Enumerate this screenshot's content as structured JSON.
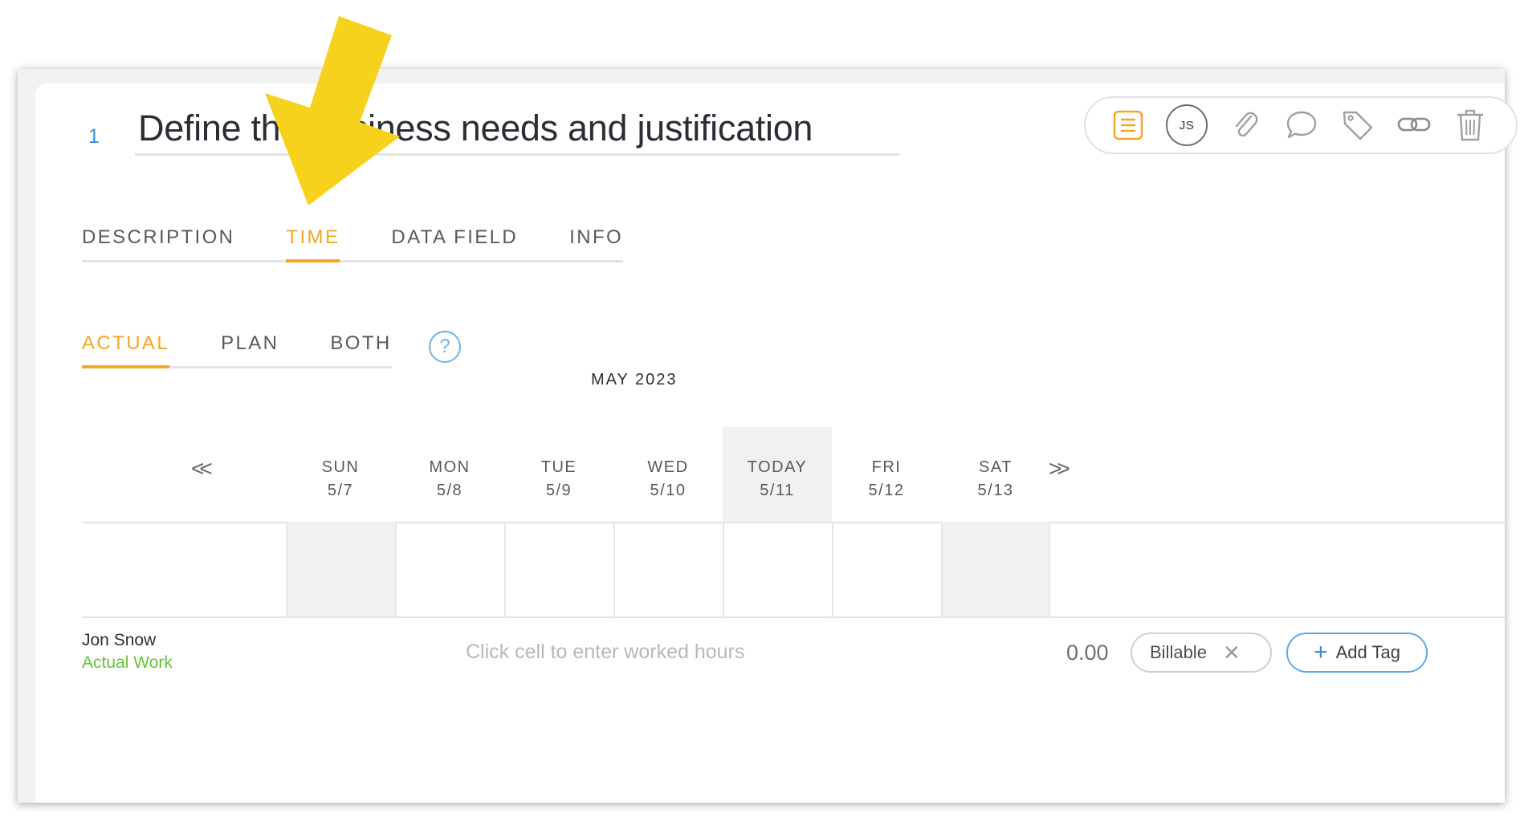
{
  "task": {
    "number": "1",
    "title": "Define the business needs and justification"
  },
  "toolbar": {
    "avatar_initials": "JS",
    "icons": [
      "list-icon",
      "avatar",
      "paperclip-icon",
      "comment-icon",
      "tag-icon",
      "link-icon",
      "trash-icon"
    ]
  },
  "tabs": [
    {
      "label": "DESCRIPTION",
      "active": false
    },
    {
      "label": "TIME",
      "active": true
    },
    {
      "label": "DATA FIELD",
      "active": false
    },
    {
      "label": "INFO",
      "active": false
    }
  ],
  "subtabs": [
    {
      "label": "ACTUAL",
      "active": true
    },
    {
      "label": "PLAN",
      "active": false
    },
    {
      "label": "BOTH",
      "active": false
    }
  ],
  "help_label": "?",
  "calendar": {
    "month": "MAY 2023",
    "prev": "<<",
    "next": ">>",
    "days": [
      {
        "name": "SUN",
        "date": "5/7"
      },
      {
        "name": "MON",
        "date": "5/8"
      },
      {
        "name": "TUE",
        "date": "5/9"
      },
      {
        "name": "WED",
        "date": "5/10"
      },
      {
        "name": "TODAY",
        "date": "5/11"
      },
      {
        "name": "FRI",
        "date": "5/12"
      },
      {
        "name": "SAT",
        "date": "5/13"
      }
    ]
  },
  "row": {
    "person": "Jon Snow",
    "work_type": "Actual Work",
    "hint": "Click cell to enter worked hours",
    "total": "0.00",
    "billable_label": "Billable",
    "add_tag_label": "Add Tag"
  },
  "colors": {
    "accent": "#f5a623",
    "link": "#3a8fd8",
    "actual_work": "#67c23a",
    "arrow": "#f7d21c"
  }
}
